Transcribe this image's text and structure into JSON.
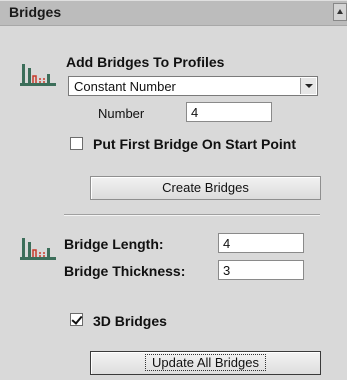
{
  "panel": {
    "title": "Bridges"
  },
  "add_bridges": {
    "label": "Add Bridges To Profiles",
    "mode_selected": "Constant Number",
    "number_label": "Number",
    "number_value": "4",
    "first_on_start_label": "Put First Bridge On Start Point",
    "first_on_start_checked": false,
    "create_button": "Create Bridges"
  },
  "bridge_settings": {
    "length_label": "Bridge Length:",
    "length_value": "4",
    "thickness_label": "Bridge Thickness:",
    "thickness_value": "3",
    "bridges_3d_label": "3D Bridges",
    "bridges_3d_checked": true,
    "update_button": "Update All Bridges"
  },
  "icons": {
    "section_icon": "bridge-tool-icon",
    "collapse": "chevron-up-icon",
    "dropdown": "chevron-down-icon"
  }
}
